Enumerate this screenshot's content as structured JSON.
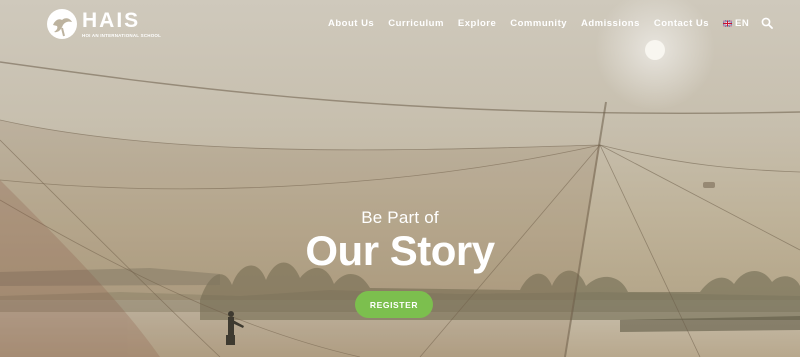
{
  "brand": {
    "name": "HAIS",
    "subtitle": "HOI AN INTERNATIONAL SCHOOL"
  },
  "nav": {
    "items": [
      "About Us",
      "Curriculum",
      "Explore",
      "Community",
      "Admissions",
      "Contact Us"
    ],
    "language": "EN"
  },
  "hero": {
    "tagline": "Be Part of",
    "headline": "Our Story",
    "cta": "REGISTER"
  },
  "colors": {
    "cta": "#7cbf4e",
    "text": "#ffffff"
  }
}
